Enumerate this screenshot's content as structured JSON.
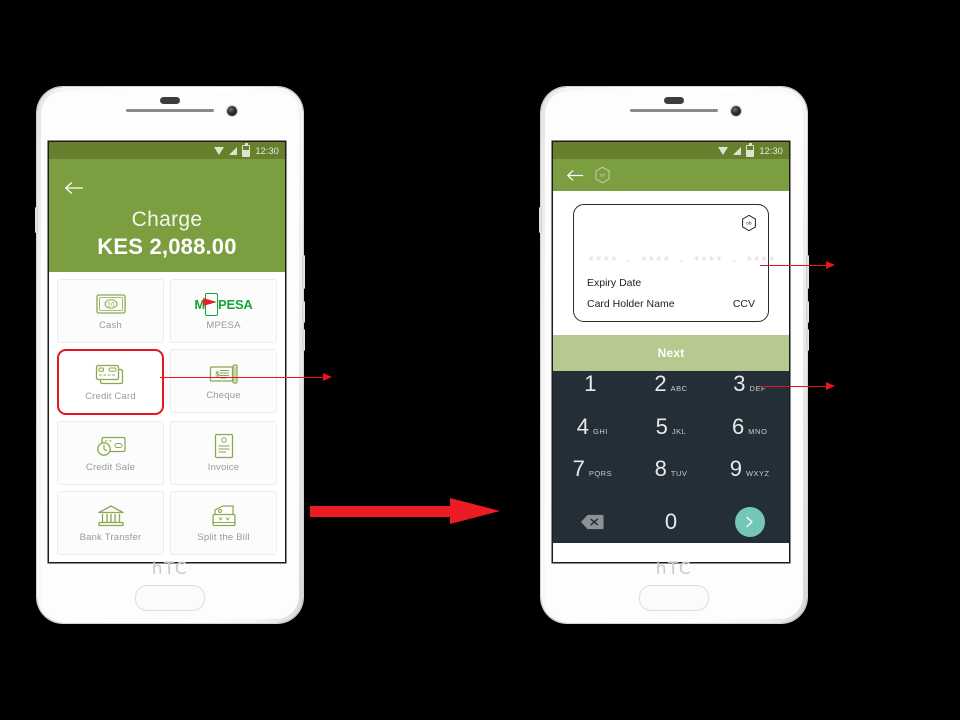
{
  "screens": {
    "charge": {
      "statusbar": {
        "time": "12:30",
        "icons": [
          "wifi-icon",
          "signal-icon",
          "battery-icon"
        ]
      },
      "back_icon": "back-arrow-icon",
      "title": "Charge",
      "amount": "KES 2,088.00",
      "methods": [
        {
          "label": "Cash",
          "icon": "banknote-icon",
          "selected": false
        },
        {
          "label": "MPESA",
          "icon": "mpesa-logo",
          "selected": false,
          "wordmark": {
            "left": "M",
            "right": "PESA"
          }
        },
        {
          "label": "Credit Card",
          "icon": "credit-card-icon",
          "selected": true
        },
        {
          "label": "Cheque",
          "icon": "cheque-icon",
          "selected": false
        },
        {
          "label": "Credit Sale",
          "icon": "credit-sale-icon",
          "selected": false
        },
        {
          "label": "Invoice",
          "icon": "invoice-icon",
          "selected": false
        },
        {
          "label": "Bank Transfer",
          "icon": "bank-icon",
          "selected": false
        },
        {
          "label": "Split the Bill",
          "icon": "split-bill-icon",
          "selected": false
        }
      ]
    },
    "card_entry": {
      "statusbar": {
        "time": "12:30",
        "icons": [
          "wifi-icon",
          "signal-icon",
          "battery-icon"
        ]
      },
      "back_icon": "back-arrow-icon",
      "toolbar_logo": "hexagon-logo-icon",
      "card": {
        "logo": "hexagon-logo-icon",
        "number_placeholder": "**** - **** - **** - ****",
        "expiry_label": "Expiry Date",
        "holder_label": "Card Holder Name",
        "ccv_label": "CCV"
      },
      "next_label": "Next",
      "keypad": {
        "keys": [
          {
            "digit": "1",
            "letters": ""
          },
          {
            "digit": "2",
            "letters": "ABC"
          },
          {
            "digit": "3",
            "letters": "DEF"
          },
          {
            "digit": "4",
            "letters": "GHI"
          },
          {
            "digit": "5",
            "letters": "JKL"
          },
          {
            "digit": "6",
            "letters": "MNO"
          },
          {
            "digit": "7",
            "letters": "PQRS"
          },
          {
            "digit": "8",
            "letters": "TUV"
          },
          {
            "digit": "9",
            "letters": "WXYZ"
          }
        ],
        "delete_icon": "backspace-icon",
        "zero": "0",
        "go_icon": "chevron-right-icon"
      }
    }
  },
  "device": {
    "brand": "hTC"
  },
  "colors": {
    "header_green": "#7a9e40",
    "statusbar_green": "#66802e",
    "next_green": "#b6c98e",
    "keypad_dark": "#242e36",
    "go_teal": "#74c7b6",
    "annotation_red": "#e8151b",
    "mpesa_green": "#13a538",
    "mpesa_red": "#e52421"
  },
  "annotations": {
    "flow_arrow": "flow-arrow",
    "callout_credit_card": "callout-credit-card",
    "callout_card_number": "callout-card-number",
    "callout_next_button": "callout-next-button"
  }
}
